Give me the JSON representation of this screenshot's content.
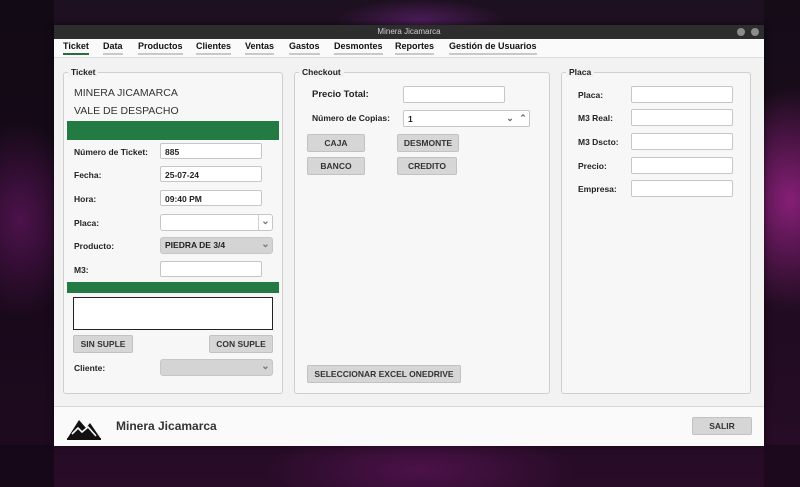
{
  "window": {
    "title": "Minera Jicamarca"
  },
  "menu": [
    "Ticket",
    "Data",
    "Productos",
    "Clientes",
    "Ventas",
    "Gastos",
    "Desmontes",
    "Reportes",
    "Gestión de Usuarios"
  ],
  "ticket": {
    "title": "Ticket",
    "company": "MINERA JICAMARCA",
    "subtitle": "VALE DE DESPACHO",
    "numero_label": "Número de Ticket:",
    "numero_value": "885",
    "fecha_label": "Fecha:",
    "fecha_value": "25-07-24",
    "hora_label": "Hora:",
    "hora_value": "09:40 PM",
    "placa_label": "Placa:",
    "placa_value": "",
    "producto_label": "Producto:",
    "producto_value": "PIEDRA DE 3/4",
    "m3_label": "M3:",
    "m3_value": "",
    "sin_suple": "SIN SUPLE",
    "con_suple": "CON SUPLE",
    "cliente_label": "Cliente:",
    "cliente_value": ""
  },
  "checkout": {
    "title": "Checkout",
    "precio_total_label": "Precio Total:",
    "precio_total_value": "",
    "copias_label": "Número de Copias:",
    "copias_value": "1",
    "caja": "CAJA",
    "desmonte": "DESMONTE",
    "banco": "BANCO",
    "credito": "CREDITO",
    "excel": "SELECCIONAR EXCEL ONEDRIVE"
  },
  "placa": {
    "title": "Placa",
    "placa_label": "Placa:",
    "m3_real_label": "M3 Real:",
    "m3_dscto_label": "M3 Dscto:",
    "precio_label": "Precio:",
    "empresa_label": "Empresa:"
  },
  "footer": {
    "brand": "Minera Jicamarca",
    "salir": "SALIR"
  },
  "colors": {
    "accent_green": "#237a42",
    "titlebar": "#2d2d2d"
  },
  "icons": {
    "logo": "mountain-logo-icon",
    "dropdown": "chevron-down-icon"
  }
}
